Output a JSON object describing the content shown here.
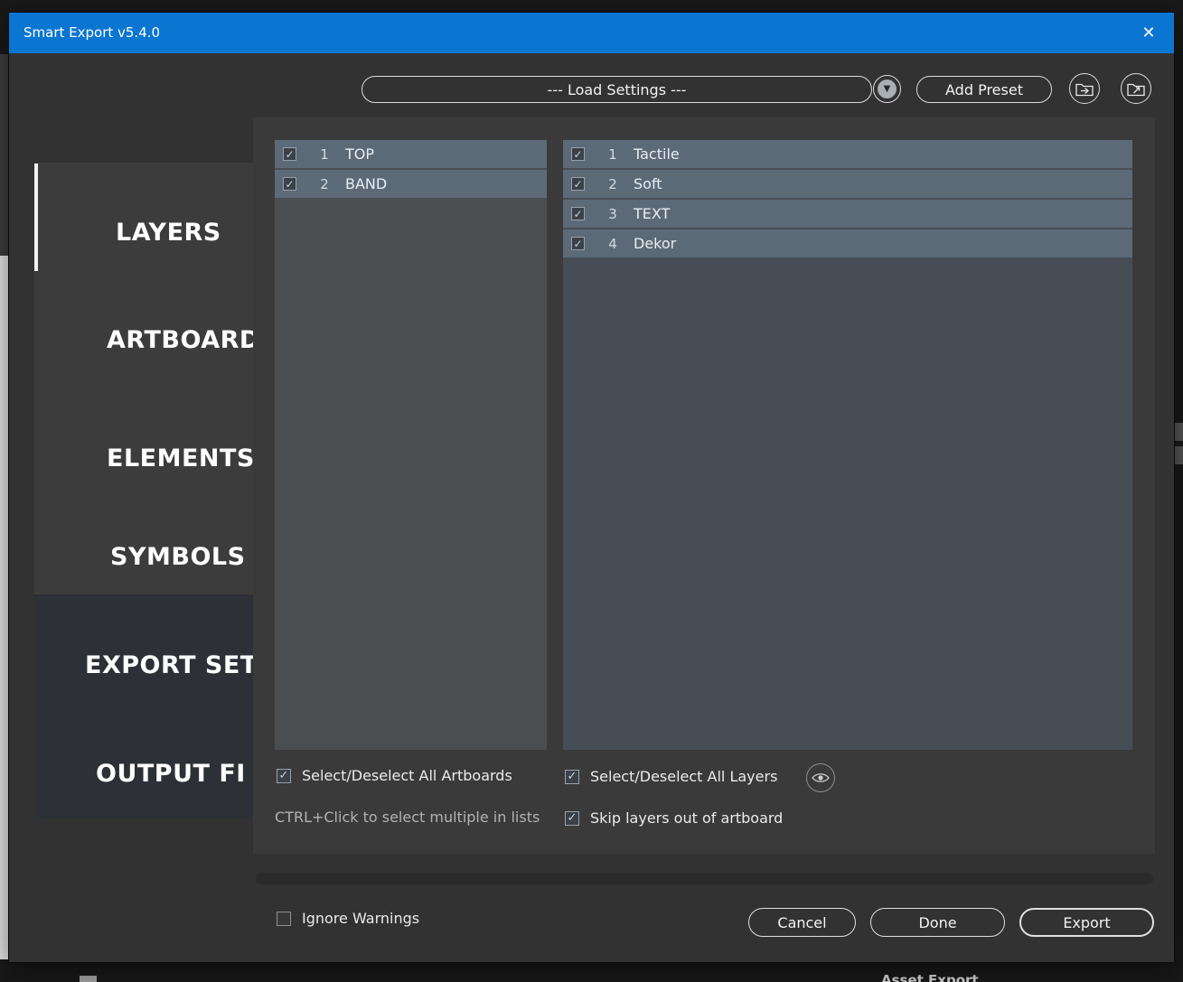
{
  "window": {
    "title": "Smart Export v5.4.0"
  },
  "icons": {
    "close": "✕",
    "check": "✓",
    "chevron_down": "▼"
  },
  "toolbar": {
    "load_settings_label": "--- Load Settings ---",
    "add_preset_label": "Add Preset"
  },
  "sidebar": {
    "tabs": [
      {
        "label": "LAYERS",
        "active": true
      },
      {
        "label": "ARTBOARD",
        "active": false
      },
      {
        "label": "ELEMENTS",
        "active": false
      },
      {
        "label": "SYMBOLS",
        "active": false
      },
      {
        "label": "EXPORT SET",
        "active": false
      },
      {
        "label": "OUTPUT FI",
        "active": false
      }
    ]
  },
  "artboards": {
    "items": [
      {
        "num": "1",
        "name": "TOP",
        "checked": true
      },
      {
        "num": "2",
        "name": "BAND",
        "checked": true
      }
    ],
    "select_all_label": "Select/Deselect All Artboards",
    "hint": "CTRL+Click to select multiple in lists"
  },
  "layers": {
    "items": [
      {
        "num": "1",
        "name": "Tactile",
        "checked": true
      },
      {
        "num": "2",
        "name": "Soft",
        "checked": true
      },
      {
        "num": "3",
        "name": "TEXT",
        "checked": true
      },
      {
        "num": "4",
        "name": "Dekor",
        "checked": true
      }
    ],
    "select_all_label": "Select/Deselect All Layers",
    "skip_label": "Skip layers out of artboard"
  },
  "footer": {
    "ignore_warnings_label": "Ignore Warnings",
    "cancel_label": "Cancel",
    "done_label": "Done",
    "export_label": "Export"
  },
  "background": {
    "asset_export_label": "Asset Export"
  },
  "colors": {
    "titlebar_blue": "#0b76d1",
    "row_selection": "#5c6a78",
    "active_tab_indicator": "#f2f2f2",
    "dialog_background": "#323232"
  }
}
